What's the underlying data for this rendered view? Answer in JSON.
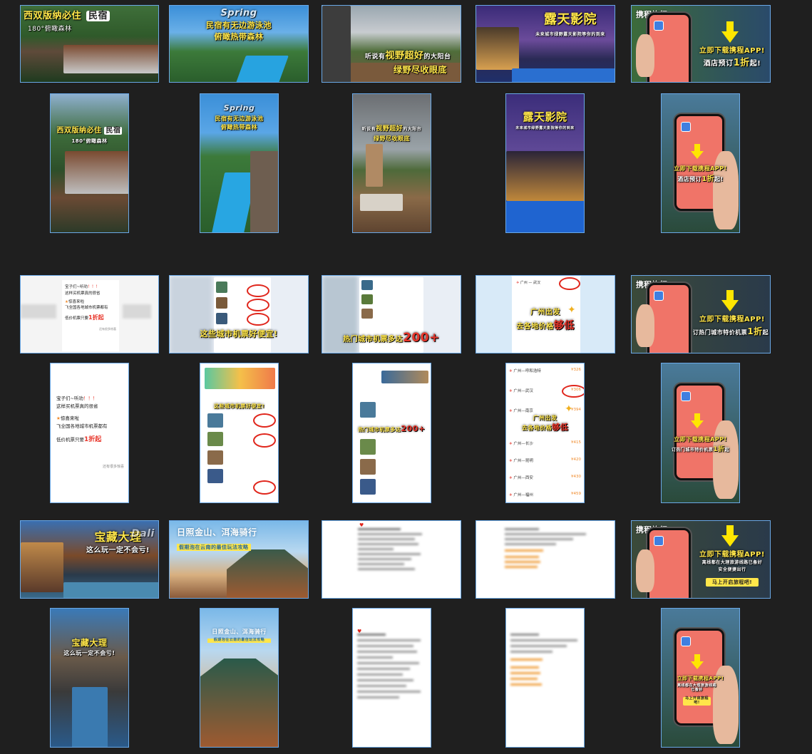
{
  "colors": {
    "background": "#1f1f1f",
    "selection_border": "#6aa8e6",
    "caption_yellow": "#ffe64a",
    "accent_red": "#e8352a",
    "phone_screen": "#f07468"
  },
  "row1": {
    "t1": {
      "title": "西双版纳必住",
      "badge": "民宿",
      "sub": "180°俯瞰森林"
    },
    "t2": {
      "script": "Spring",
      "line1": "民宿有无边游泳池",
      "line2": "俯瞰热带森林"
    },
    "t3": {
      "pre": "听说有",
      "highlight": "视野超好",
      "post": "的大阳台",
      "line2": "绿野尽收眼底"
    },
    "t4": {
      "title": "露天影院",
      "sub": "未来城市绿野露天影院等你的到来"
    },
    "t5": {
      "brand": "携程旅行",
      "line1": "立即下载携程APP!",
      "line2a": "酒店预订",
      "line2b": "1折",
      "line2c": "起!"
    }
  },
  "row2": {
    "t1": {
      "title": "西双版纳必住",
      "badge": "民宿",
      "sub": "180°俯瞰森林"
    },
    "t2": {
      "script": "Spring",
      "line1": "民宿有无边游泳池",
      "line2": "俯瞰热带森林"
    },
    "t3": {
      "pre": "听说有",
      "highlight": "视野超好",
      "post": "的大阳台",
      "line2": "绿野尽收眼底"
    },
    "t4": {
      "title": "露天影院",
      "sub": "未来城市绿野露天影院等你的到来"
    },
    "t5": {
      "line1": "立即下载携程APP!",
      "line2a": "酒店预订",
      "line2b": "1折",
      "line2c": "起!"
    }
  },
  "row3": {
    "t1": {
      "line1": "宝子们~听劝",
      "excl": "！！！",
      "line2": "这样买机票真的很省",
      "line3": "惊喜来啦",
      "line4": "飞全国各地城市机票都有",
      "line5a": "低价机票只要",
      "line5b": "1折起",
      "foot": "还有很多惊喜"
    },
    "t2": {
      "caption": "这些城市机票好便宜!"
    },
    "t3": {
      "caption_a": "热门城市机票多达",
      "caption_b": "200+"
    },
    "t4": {
      "city_from": "广州",
      "city_to": "武汉",
      "caption_a": "广州出发",
      "caption_b": "去各地价格",
      "caption_c": "够低"
    },
    "t5": {
      "brand": "携程旅行",
      "line1": "立即下载携程APP!",
      "line2a": "订热门城市特价机票",
      "line2b": "1折",
      "line2c": "起"
    }
  },
  "row4": {
    "t1": {
      "line1": "宝子们~听劝",
      "excl": "！！！",
      "line2": "这样买机票真的很省",
      "line3": "惊喜来啦",
      "line4": "飞全国各地城市机票都有",
      "line5a": "低价机票只要",
      "line5b": "1折起",
      "foot": "还有很多惊喜"
    },
    "t2": {
      "caption": "这些城市机票好便宜!"
    },
    "t3": {
      "caption_a": "热门城市机票多达",
      "caption_b": "200+"
    },
    "t4": {
      "routes": [
        {
          "from": "广州",
          "to": "呼和浩特",
          "price": "¥326"
        },
        {
          "from": "广州",
          "to": "武汉",
          "price": "¥306"
        },
        {
          "from": "广州",
          "to": "南京",
          "price": "¥394"
        },
        {
          "from": "广州",
          "to": "长沙",
          "price": "¥415"
        },
        {
          "from": "广州",
          "to": "昆明",
          "price": "¥420"
        },
        {
          "from": "广州",
          "to": "西安",
          "price": "¥430"
        },
        {
          "from": "广州",
          "to": "福州",
          "price": "¥459"
        }
      ],
      "caption_a": "广州出发",
      "caption_b": "去各地价格",
      "caption_c": "够低"
    },
    "t5": {
      "line1": "立即下载携程APP!",
      "line2a": "订热门城市特价机票",
      "line2b": "1折",
      "line2c": "起"
    }
  },
  "row5": {
    "t1": {
      "title": "宝藏大理",
      "sub": "这么玩一定不会亏!",
      "script": "Dali"
    },
    "t2": {
      "line1": "日照金山、洱海骑行",
      "line2": "假期泡在云南的最佳玩法攻略"
    },
    "t5": {
      "brand": "携程旅行",
      "line1": "立即下载携程APP!",
      "line2": "离线都在大理旅游线路已备好",
      "line3": "安全便捷出行",
      "button": "马上开启旅程吧!"
    }
  },
  "row6": {
    "t1": {
      "title": "宝藏大理",
      "sub": "这么玩一定不会亏!"
    },
    "t2": {
      "line1": "日照金山、洱海骑行",
      "line2": "假期泡在云南的最佳玩法攻略"
    },
    "t5": {
      "line1": "立即下载携程APP!",
      "line2": "离线都在大理旅游线路已备好",
      "button": "马上开启旅程吧!"
    }
  }
}
